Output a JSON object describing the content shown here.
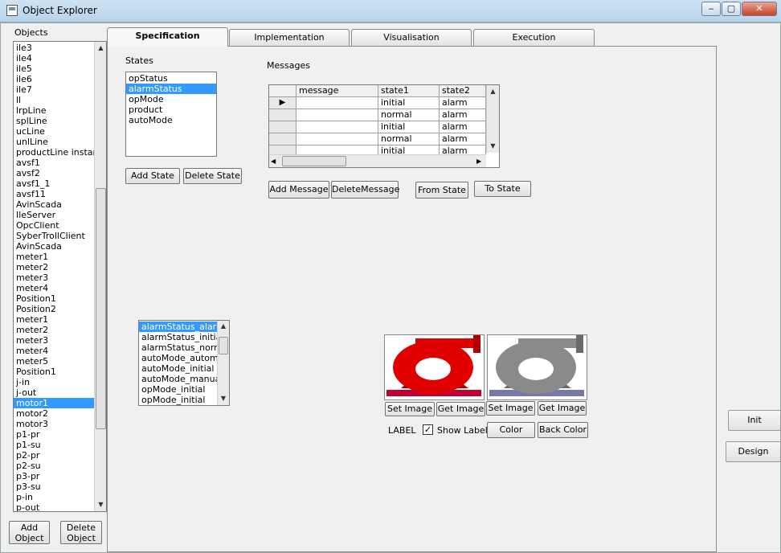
{
  "window": {
    "title": "Object Explorer",
    "min": "‒",
    "max": "▢",
    "close": "✕",
    "icon": "app-window-icon"
  },
  "objects": {
    "label": "Objects",
    "items": [
      "ile3",
      "ile4",
      "ile5",
      "ile6",
      "ile7",
      "ll",
      "lrpLine",
      "splLine",
      "ucLine",
      "unlLine",
      "productLine instance",
      "avsf1",
      "avsf2",
      "avsf1_1",
      "avsf11",
      "AvinScada",
      "IleServer",
      "OpcClient",
      "SyberTrollClient",
      "AvinScada",
      "meter1",
      "meter2",
      "meter3",
      "meter4",
      "Position1",
      "Position2",
      "meter1",
      "meter2",
      "meter3",
      "meter4",
      "meter5",
      "Position1",
      "j-in",
      "j-out",
      "motor1",
      "motor2",
      "motor3",
      "p1-pr",
      "p1-su",
      "p2-pr",
      "p2-su",
      "p3-pr",
      "p3-su",
      "p-in",
      "p-out"
    ],
    "selected_index": 34,
    "add_button": "Add Object",
    "delete_button": "Delete Object"
  },
  "tabs": [
    "Specification",
    "Implementation",
    "Visualisation",
    "Execution"
  ],
  "active_tab": 0,
  "states": {
    "label": "States",
    "items": [
      "opStatus",
      "alarmStatus",
      "opMode",
      "product",
      "autoMode"
    ],
    "selected_index": 1,
    "add_button": "Add State",
    "delete_button": "Delete State"
  },
  "messages": {
    "label": "Messages",
    "columns": [
      "message",
      "state1",
      "state2"
    ],
    "rows": [
      {
        "message": "",
        "state1": "initial",
        "state2": "alarm"
      },
      {
        "message": "",
        "state1": "normal",
        "state2": "alarm"
      },
      {
        "message": "",
        "state1": "initial",
        "state2": "alarm"
      },
      {
        "message": "",
        "state1": "normal",
        "state2": "alarm"
      },
      {
        "message": "",
        "state1": "initial",
        "state2": "alarm"
      }
    ],
    "current_row_marker": "▶",
    "add_button": "Add Message",
    "delete_button": "DeleteMessage",
    "from_state_button": "From State",
    "to_state_button": "To State"
  },
  "state_values": {
    "items": [
      "alarmStatus_alarm",
      "alarmStatus_initial",
      "alarmStatus_normal",
      "autoMode_automat",
      "autoMode_initial",
      "autoMode_manual",
      "opMode_initial",
      "opMode_initial"
    ],
    "selected_index": 0
  },
  "images": {
    "left": {
      "set": "Set Image",
      "get": "Get Image",
      "color": "#e00000"
    },
    "right": {
      "set": "Set Image",
      "get": "Get Image",
      "color": "#8a8a8a"
    }
  },
  "label_row": {
    "label": "LABEL",
    "show_label": "Show Label",
    "checked": "✓",
    "color_button": "Color",
    "back_color_button": "Back Color"
  },
  "right_panel": {
    "init": "Init",
    "design": "Design"
  }
}
